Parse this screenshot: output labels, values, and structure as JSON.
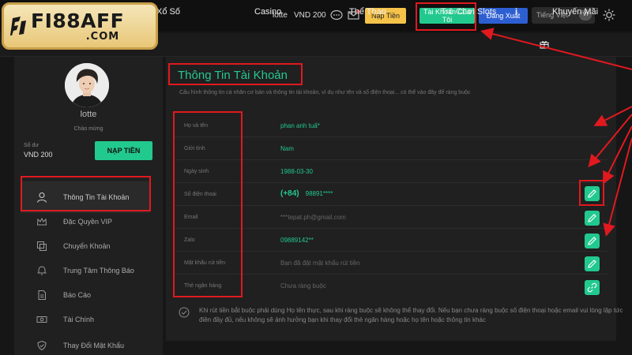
{
  "brand": {
    "name": "FI88AFF",
    "domain": ".COM",
    "accent_color": "#22c98f",
    "highlight_color": "#e0191f"
  },
  "header": {
    "username": "lotte",
    "balance": "VND 200",
    "deposit_label": "Nạp Tiền",
    "account_label": "Tài Khoản Của Tôi",
    "logout_label": "Đăng Xuất",
    "language": {
      "selected": "Tiếng Việt",
      "chip": "VI"
    },
    "icons": [
      "chat-icon",
      "mail-icon",
      "theme-toggle-icon"
    ]
  },
  "nav": {
    "items": [
      {
        "label": "Xổ Số"
      },
      {
        "label": "Casino"
      },
      {
        "label": "Thể Thao"
      },
      {
        "label": "Trò Chơi Slots"
      },
      {
        "label": "Khuyến Mãi"
      }
    ]
  },
  "sidebar": {
    "username": "lotte",
    "welcome": "Chào mừng",
    "balance_label": "Số dư",
    "balance": "VND 200",
    "deposit_label": "NẠP TIỀN",
    "items": [
      {
        "label": "Thông Tin Tài Khoản",
        "icon": "user-icon",
        "active": true
      },
      {
        "label": "Đặc Quyền VIP",
        "icon": "crown-icon"
      },
      {
        "label": "Chuyển Khoản",
        "icon": "transfer-icon"
      },
      {
        "label": "Trung Tâm Thông Báo",
        "icon": "bell-icon"
      },
      {
        "label": "Báo Cáo",
        "icon": "report-icon"
      },
      {
        "label": "Tài Chính",
        "icon": "money-icon"
      },
      {
        "label": "Thay Đổi Mật Khẩu",
        "icon": "shield-icon"
      }
    ]
  },
  "main": {
    "title": "Thông Tin Tài Khoản",
    "description": "Cấu hình thông tin cá nhân cơ bản và thông tin tài khoản, ví dụ như tên và số điện thoại... có thể vào đây để ràng buộc",
    "fields": [
      {
        "label": "Họ và tên",
        "value": "phan anh tuấ*"
      },
      {
        "label": "Giới tính",
        "value": "Nam"
      },
      {
        "label": "Ngày sinh",
        "value": "1988-03-30"
      },
      {
        "label": "Số điện thoại",
        "prefix": "(+84)",
        "value": "98891****"
      },
      {
        "label": "Email",
        "value": "***tepat.ph@gmail.com"
      },
      {
        "label": "Zalo",
        "value": "09889142**"
      },
      {
        "label": "Mật khẩu rút tiền",
        "value": "Bạn đã đặt mật khẩu rút tiền"
      },
      {
        "label": "Thẻ ngân hàng",
        "value": "Chưa ràng buộc"
      }
    ],
    "note": "Khi rút tiền bắt buộc phải dùng Họ tên thực, sau khi ràng buộc sẽ không thể thay đổi. Nếu bạn chưa ràng buộc số điện thoại hoặc email vui lòng lập tức điền đầy đủ, nếu không sẽ ảnh hưởng bạn khi thay đổi thẻ ngân hàng hoặc họ tên hoặc thông tin khác"
  }
}
